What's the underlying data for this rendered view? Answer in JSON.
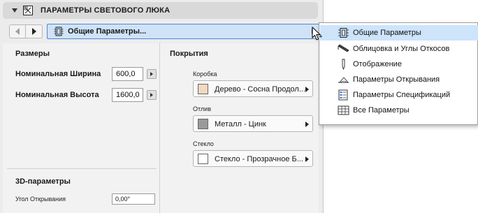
{
  "header": {
    "title": "ПАРАМЕТРЫ СВЕТОВОГО ЛЮКА"
  },
  "nav": {
    "page_selected": "Общие Параметры..."
  },
  "sizes": {
    "title": "Размеры",
    "width_label": "Номинальная Ширина",
    "width_value": "600,0",
    "height_label": "Номинальная Высота",
    "height_value": "1600,0"
  },
  "params3d": {
    "title": "3D-параметры",
    "angle_label": "Угол Открывания",
    "angle_value": "0,00°"
  },
  "coverings": {
    "title": "Покрытия",
    "items": [
      {
        "label": "Коробка",
        "value": "Дерево - Сосна Продол...",
        "color": "#f2d9bf"
      },
      {
        "label": "Отлив",
        "value": "Металл - Цинк",
        "color": "#9a9a9a"
      },
      {
        "label": "Стекло",
        "value": "Стекло - Прозрачное Б...",
        "color": "#ffffff"
      }
    ]
  },
  "menu": {
    "items": [
      {
        "label": "Общие Параметры",
        "icon": "general-params-icon",
        "selected": true
      },
      {
        "label": "Облицовка и Углы Откосов",
        "icon": "cladding-icon",
        "selected": false
      },
      {
        "label": "Отображение",
        "icon": "display-icon",
        "selected": false
      },
      {
        "label": "Параметры Открывания",
        "icon": "opening-icon",
        "selected": false
      },
      {
        "label": "Параметры Спецификаций",
        "icon": "specification-icon",
        "selected": false
      },
      {
        "label": "Все Параметры",
        "icon": "all-params-icon",
        "selected": false
      }
    ]
  },
  "colors": {
    "accent": "#4a8ad4",
    "selection": "#cde4fb",
    "panel_bg": "#ececec"
  }
}
